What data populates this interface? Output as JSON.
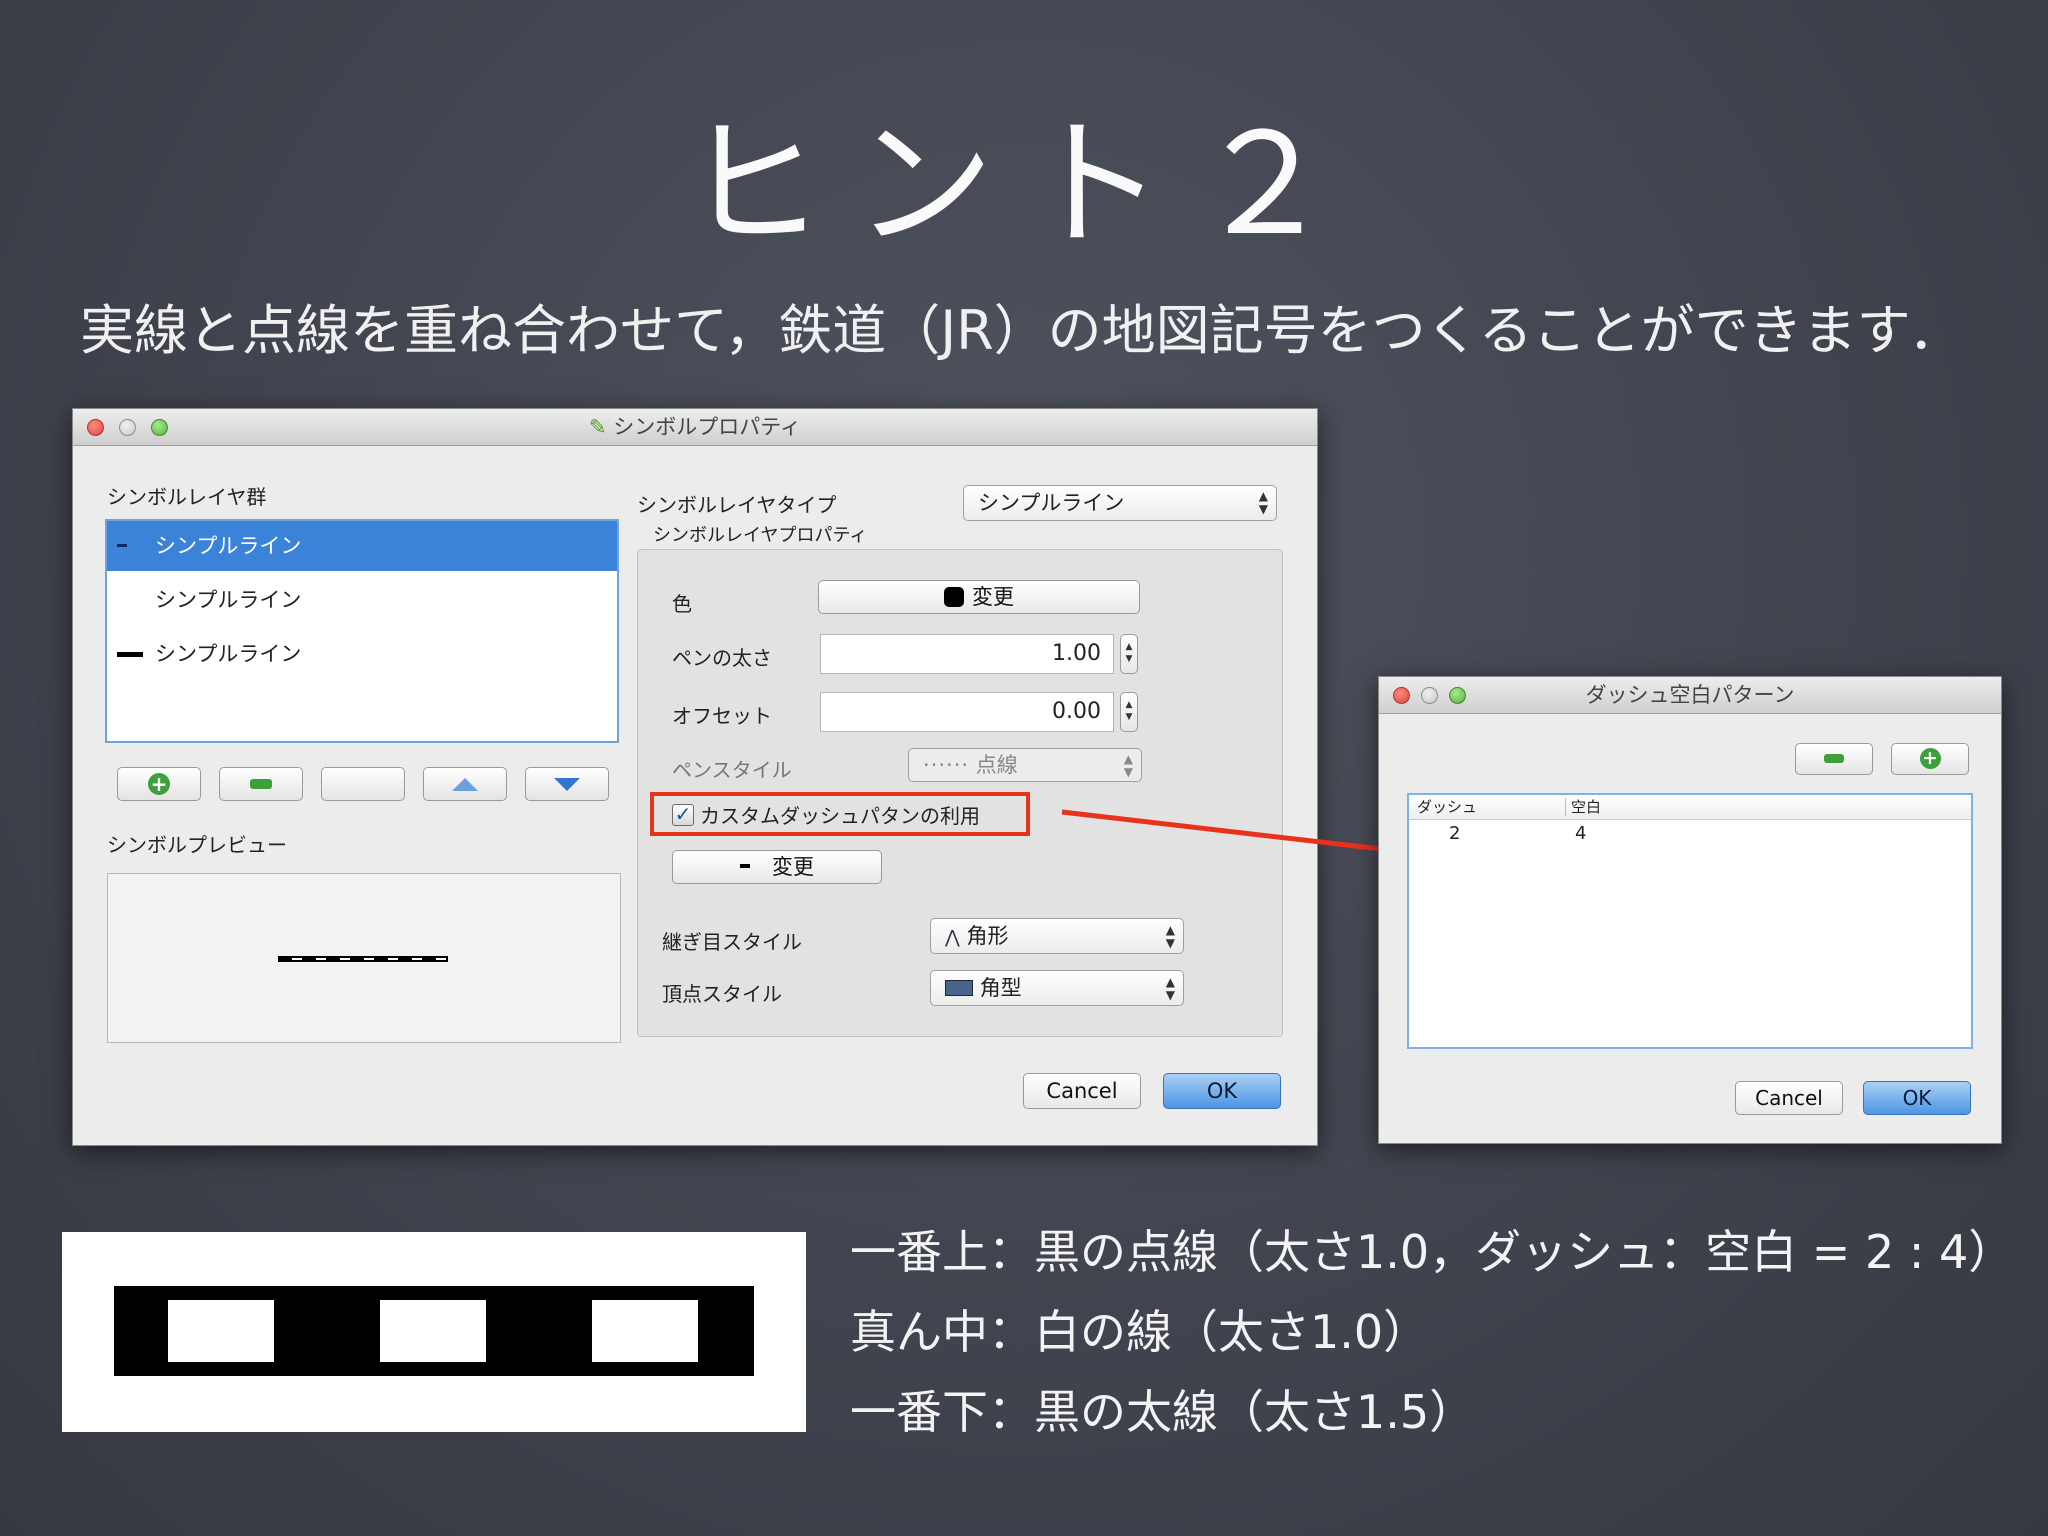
{
  "slide": {
    "title": "ヒント２",
    "subtitle": "実線と点線を重ね合わせて，鉄道（JR）の地図記号をつくることができます．",
    "notes": [
      "一番上：黒の点線（太さ1.0，ダッシュ：空白 = 2 : 4）",
      "真ん中：白の線（太さ1.0）",
      "一番下：黒の太線（太さ1.5）"
    ]
  },
  "symbol_window": {
    "title": "シンボルプロパティ",
    "layers_label": "シンボルレイヤ群",
    "layers": [
      {
        "label": "シンプルライン",
        "selected": true
      },
      {
        "label": "シンプルライン",
        "selected": false
      },
      {
        "label": "シンプルライン",
        "selected": false
      }
    ],
    "preview_label": "シンボルプレビュー",
    "layer_type_label": "シンボルレイヤタイプ",
    "layer_type_value": "シンプルライン",
    "layer_props_label": "シンボルレイヤプロパティ",
    "color_label": "色",
    "color_button": "変更",
    "pen_width_label": "ペンの太さ",
    "pen_width_value": "1.00",
    "offset_label": "オフセット",
    "offset_value": "0.00",
    "pen_style_label": "ペンスタイル",
    "pen_style_value": "点線",
    "custom_dash_label": "カスタムダッシュパタンの利用",
    "custom_dash_checked": true,
    "dash_change_button": "変更",
    "join_style_label": "継ぎ目スタイル",
    "join_style_value": "角形",
    "cap_style_label": "頂点スタイル",
    "cap_style_value": "角型",
    "cancel": "Cancel",
    "ok": "OK"
  },
  "dash_window": {
    "title": "ダッシュ空白パターン",
    "columns": [
      "ダッシュ",
      "空白"
    ],
    "rows": [
      [
        "2",
        "4"
      ]
    ],
    "cancel": "Cancel",
    "ok": "OK"
  },
  "colors": {
    "highlight": "#e8321e",
    "selection": "#3b82d9",
    "ok_button": "#4d95e4"
  }
}
